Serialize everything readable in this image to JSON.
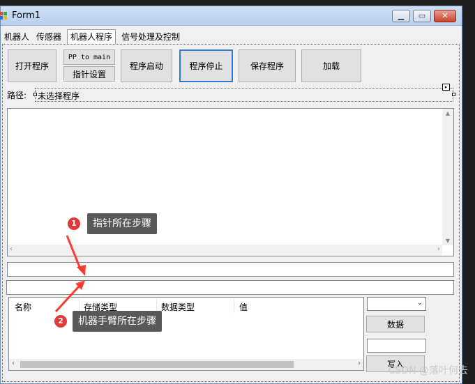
{
  "window": {
    "title": "Form1"
  },
  "tabs": [
    {
      "label": "机器人"
    },
    {
      "label": "传感器"
    },
    {
      "label": "机器人程序"
    },
    {
      "label": "信号处理及控制"
    }
  ],
  "toolbar": {
    "open_label": "打开程序",
    "pp_to_main_label": "PP to main",
    "pointer_set_label": "指针设置",
    "start_label": "程序启动",
    "stop_label": "程序停止",
    "save_label": "保存程序",
    "load_label": "加载"
  },
  "path": {
    "label": "路径:",
    "value": "未选择程序"
  },
  "callouts": [
    {
      "num": "1",
      "text": "指针所在步骤"
    },
    {
      "num": "2",
      "text": "机器手臂所在步骤"
    }
  ],
  "table": {
    "columns": [
      "名称",
      "存储类型",
      "数据类型",
      "值"
    ]
  },
  "side": {
    "data_label": "数据",
    "write_label": "写入"
  },
  "watermark": "CSDN @落叶何去",
  "colors": {
    "accent": "#2f7bd4",
    "callout_bg": "#595959",
    "badge": "#e03a3a",
    "arrow": "#ff3b30"
  }
}
